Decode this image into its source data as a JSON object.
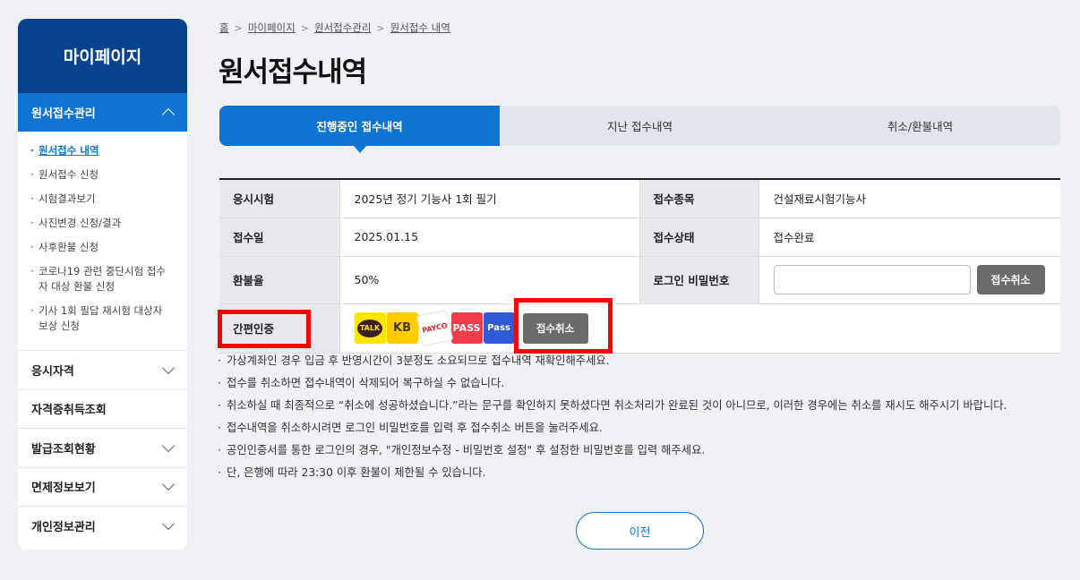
{
  "sidebar": {
    "title": "마이페이지",
    "active_group": "원서접수관리",
    "sub_items": [
      "원서접수 내역",
      "원서접수 신청",
      "시험결과보기",
      "사진변경 신청/결과",
      "사후환불 신청",
      "코로나19 관련 중단시험 접수자 대상 환불 신청",
      "기사 1회 필답 재시험 대상자 보상 신청"
    ],
    "groups": [
      "응시자격",
      "자격증취득조회",
      "발급조회현황",
      "면제정보보기",
      "개인정보관리"
    ]
  },
  "breadcrumb": [
    "홈",
    "마이페이지",
    "원서접수관리",
    "원서접수 내역"
  ],
  "page_title": "원서접수내역",
  "tabs": [
    "진행중인 접수내역",
    "지난 접수내역",
    "취소/환불내역"
  ],
  "table": {
    "exam_label": "응시시험",
    "exam_value": "2025년 정기 기능사 1회 필기",
    "type_label": "접수종목",
    "type_value": "건설재료시험기능사",
    "date_label": "접수일",
    "date_value": "2025.01.15",
    "status_label": "접수상태",
    "status_value": "접수완료",
    "refund_label": "환불율",
    "refund_value": "50%",
    "pw_label": "로그인 비밀번호",
    "cancel_button": "접수취소",
    "auth_label": "간편인증",
    "auth_icons": [
      "TALK",
      "KB",
      "PAYCO",
      "PASS",
      "Pass"
    ],
    "auth_cancel_button": "접수취소"
  },
  "notes": [
    "가상계좌인 경우 입금 후 반영시간이 3분정도 소요되므로 접수내역 재확인해주세요.",
    "접수를 취소하면 접수내역이 삭제되어 복구하실 수 없습니다.",
    "취소하실 때 최종적으로 “취소에 성공하셨습니다.”라는 문구를 확인하지 못하셨다면 취소처리가 완료된 것이 아니므로, 이러한 경우에는 취소를 재시도 해주시기 바랍니다.",
    "접수내역을 취소하시려면 로그인 비밀번호를 입력 후 접수취소 버튼을 눌러주세요.",
    "공인인증서를 통한 로그인의 경우, \"개인정보수정 - 비밀번호 설정\" 후 설정한 비밀번호를 입력 해주세요.",
    "단, 은행에 따라 23:30 이후 환불이 제한될 수 있습니다."
  ],
  "prev_button": "이전",
  "colors": {
    "primary": "#0e74d1",
    "navy": "#05438f",
    "highlight": "#ff0000"
  }
}
